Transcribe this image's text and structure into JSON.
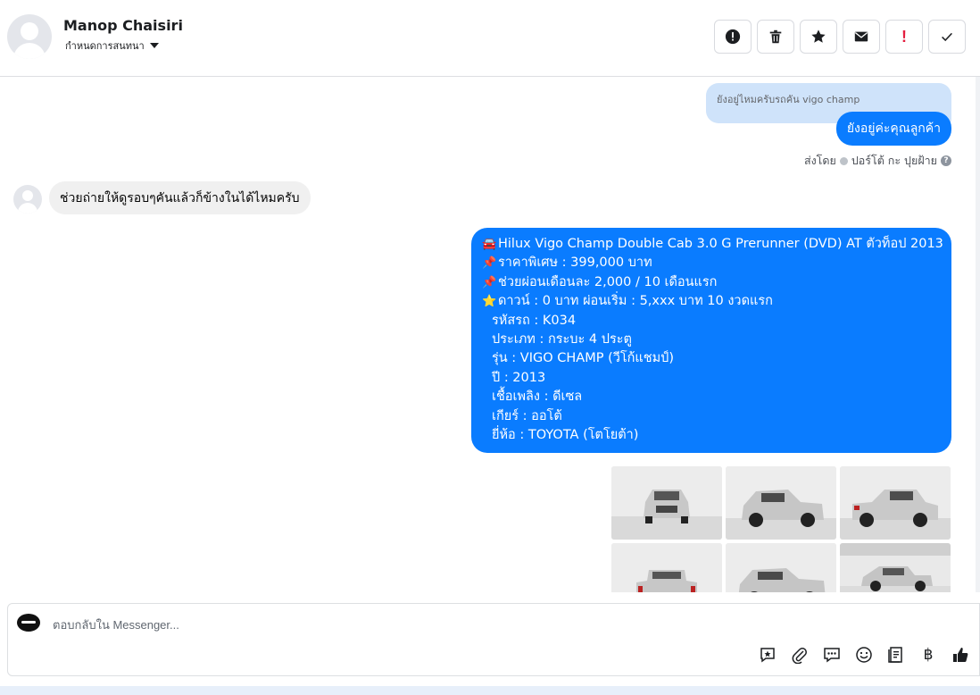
{
  "header": {
    "contact_name": "Manop Chaisiri",
    "assign_label": "กำหนดการสนทนา",
    "toolbar": [
      {
        "name": "spam-button",
        "icon": "alert-circle-icon"
      },
      {
        "name": "delete-button",
        "icon": "trash-icon"
      },
      {
        "name": "star-button",
        "icon": "star-icon"
      },
      {
        "name": "mark-unread-button",
        "icon": "envelope-icon"
      },
      {
        "name": "follow-up-button",
        "icon": "exclamation-icon",
        "label": "!"
      },
      {
        "name": "mark-done-button",
        "icon": "check-icon"
      }
    ]
  },
  "thread": {
    "quoted_text": "ยังอยู่ไหมครับรถคัน vigo champ",
    "reply_text": "ยังอยู่ค่ะคุณลูกค้า",
    "sent_by_prefix": "ส่งโดย",
    "sent_by_name": "ปอร์โต้ กะ ปุยฝ้าย",
    "incoming_text": "ช่วยถ่ายให้ดูรอบๆคันแล้วก็ข้างในได้ไหมครับ",
    "car_listing": {
      "lines": [
        {
          "emoji": "🚘",
          "text": "Hilux Vigo Champ Double Cab 3.0 G Prerunner (DVD) AT ตัวท็อป  2013"
        },
        {
          "emoji": "📌",
          "text": "ราคาพิเศษ : 399,000 บาท"
        },
        {
          "emoji": "📌",
          "text": "ช่วยผ่อนเดือนละ 2,000 / 10 เดือนแรก"
        },
        {
          "emoji": "⭐",
          "text": "ดาวน์ : 0 บาท ผ่อนเริ่ม : 5,xxx บาท 10 งวดแรก"
        },
        {
          "emoji": "",
          "text": "รหัสรถ : K034"
        },
        {
          "emoji": "",
          "text": "ประเภท : กระบะ 4 ประตู"
        },
        {
          "emoji": "",
          "text": "รุ่น : VIGO CHAMP (วีโก้แชมป์)"
        },
        {
          "emoji": "",
          "text": "ปี : 2013"
        },
        {
          "emoji": "",
          "text": "เชื้อเพลิง : ดีเซล"
        },
        {
          "emoji": "",
          "text": "เกียร์ : ออโต้"
        },
        {
          "emoji": "",
          "text": "ยี่ห้อ : TOYOTA (โตโยต้า)"
        }
      ]
    },
    "photos": [
      "front",
      "front-left",
      "rear-right",
      "rear",
      "front-left-2",
      "side"
    ]
  },
  "composer": {
    "placeholder": "ตอบกลับใน Messenger...",
    "tools": [
      "saved-reply-icon",
      "attachment-icon",
      "chat-bubbles-icon",
      "emoji-icon",
      "catalog-icon",
      "payment-icon",
      "like-icon"
    ],
    "currency_symbol": "฿"
  },
  "colors": {
    "outgoing_bubble": "#0a7cff",
    "quoted_bubble": "#cfe3fa",
    "incoming_bubble": "#f0f0f0",
    "alert_red": "#e41e3f"
  }
}
